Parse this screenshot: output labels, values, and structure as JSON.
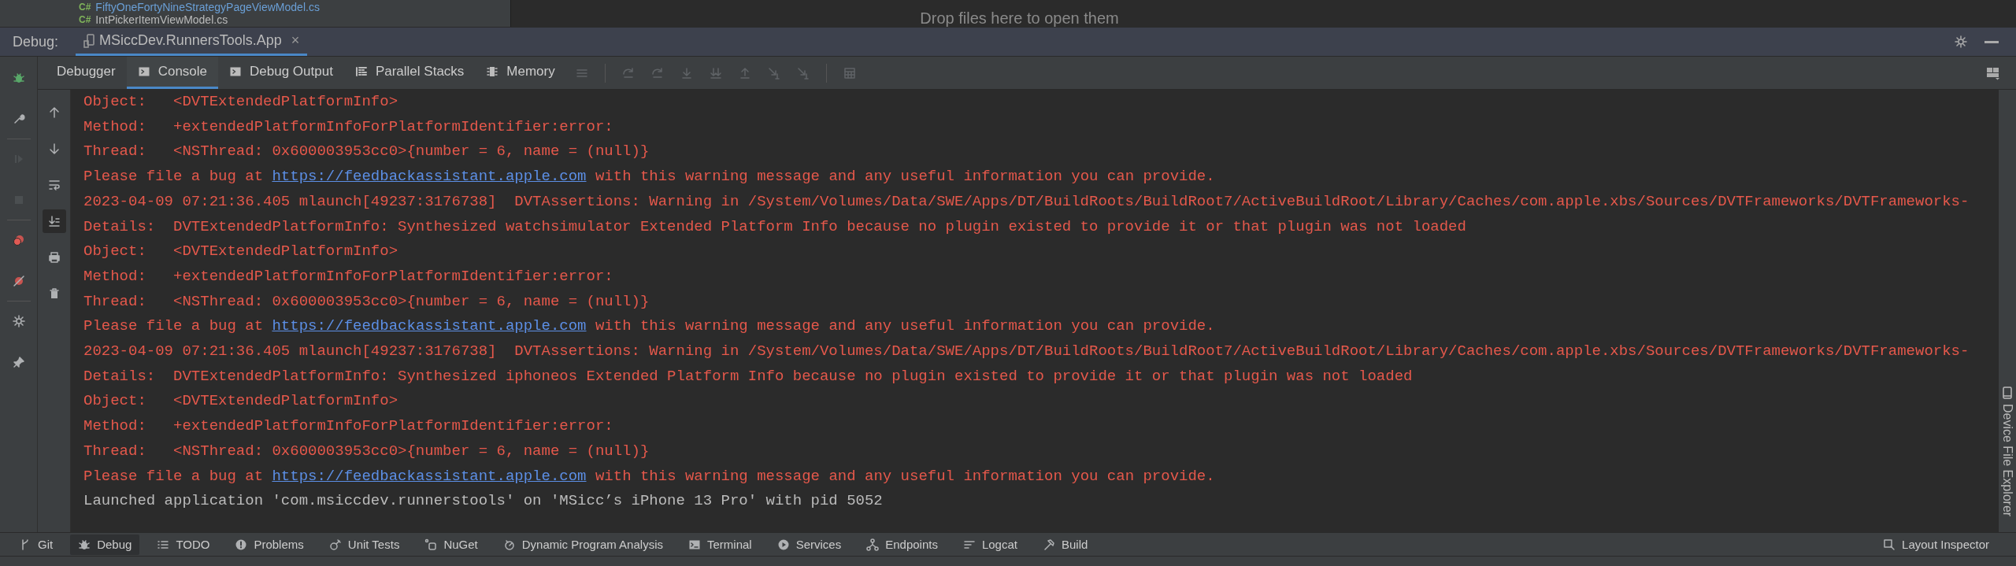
{
  "file_tree": {
    "files": [
      {
        "badge": "C#",
        "name": "FiftyOneFortyNineStrategyPageViewModel.cs"
      },
      {
        "badge": "C#",
        "name": "IntPickerItemViewModel.cs"
      }
    ]
  },
  "editor_hint": "Drop files here to open them",
  "debug_header": {
    "label": "Debug:",
    "session_tab": {
      "title": "MSiccDev.RunnersTools.App",
      "close": "×",
      "selected": true
    }
  },
  "debug_tabs": [
    {
      "label": "Debugger",
      "kind": "plain",
      "selected": false
    },
    {
      "label": "Console",
      "kind": "console",
      "selected": true
    },
    {
      "label": "Debug Output",
      "kind": "console",
      "selected": false
    },
    {
      "label": "Parallel Stacks",
      "kind": "stacks",
      "selected": false
    },
    {
      "label": "Memory",
      "kind": "memory",
      "selected": false
    }
  ],
  "toolbar": [
    {
      "kind": "menu",
      "disabled": true
    },
    {
      "kind": "stepover",
      "disabled": true
    },
    {
      "kind": "stepover",
      "disabled": true
    },
    {
      "kind": "stepinto",
      "disabled": true
    },
    {
      "kind": "forcestep",
      "disabled": true
    },
    {
      "kind": "stepout",
      "disabled": true
    },
    {
      "kind": "cursor",
      "disabled": true
    },
    {
      "kind": "cursor",
      "disabled": true
    },
    {
      "kind": "calculator",
      "disabled": true
    }
  ],
  "left_tools": [
    {
      "kind": "bug",
      "disabled": false
    },
    {
      "kind": "wrench",
      "disabled": false
    },
    {
      "kind": "resume",
      "disabled": true
    },
    {
      "kind": "stop",
      "disabled": true
    },
    {
      "kind": "breakpoints",
      "disabled": false
    },
    {
      "kind": "mute",
      "disabled": false
    },
    {
      "kind": "settings",
      "disabled": false
    },
    {
      "kind": "pin",
      "disabled": false
    }
  ],
  "console_tools": [
    {
      "kind": "up",
      "selected": false
    },
    {
      "kind": "down",
      "selected": false
    },
    {
      "kind": "wrap",
      "selected": false
    },
    {
      "kind": "scrollend",
      "selected": true
    },
    {
      "kind": "print",
      "selected": false
    },
    {
      "kind": "trash",
      "selected": false
    }
  ],
  "console_lines": [
    {
      "kind": "error",
      "text": "Object:   <DVTExtendedPlatformInfo>"
    },
    {
      "kind": "error",
      "text": "Method:   +extendedPlatformInfoForPlatformIdentifier:error:"
    },
    {
      "kind": "error",
      "text": "Thread:   <NSThread: 0x600003953cc0>{number = 6, name = (null)}"
    },
    {
      "kind": "error",
      "text": "Please file a bug at ",
      "link": "https://feedbackassistant.apple.com",
      "after": " with this warning message and any useful information you can provide."
    },
    {
      "kind": "error",
      "text": "2023-04-09 07:21:36.405 mlaunch[49237:3176738]  DVTAssertions: Warning in /System/Volumes/Data/SWE/Apps/DT/BuildRoots/BuildRoot7/ActiveBuildRoot/Library/Caches/com.apple.xbs/Sources/DVTFrameworks/DVTFrameworks-"
    },
    {
      "kind": "error",
      "text": "Details:  DVTExtendedPlatformInfo: Synthesized watchsimulator Extended Platform Info because no plugin existed to provide it or that plugin was not loaded"
    },
    {
      "kind": "error",
      "text": "Object:   <DVTExtendedPlatformInfo>"
    },
    {
      "kind": "error",
      "text": "Method:   +extendedPlatformInfoForPlatformIdentifier:error:"
    },
    {
      "kind": "error",
      "text": "Thread:   <NSThread: 0x600003953cc0>{number = 6, name = (null)}"
    },
    {
      "kind": "error",
      "text": "Please file a bug at ",
      "link": "https://feedbackassistant.apple.com",
      "after": " with this warning message and any useful information you can provide."
    },
    {
      "kind": "error",
      "text": "2023-04-09 07:21:36.405 mlaunch[49237:3176738]  DVTAssertions: Warning in /System/Volumes/Data/SWE/Apps/DT/BuildRoots/BuildRoot7/ActiveBuildRoot/Library/Caches/com.apple.xbs/Sources/DVTFrameworks/DVTFrameworks-"
    },
    {
      "kind": "error",
      "text": "Details:  DVTExtendedPlatformInfo: Synthesized iphoneos Extended Platform Info because no plugin existed to provide it or that plugin was not loaded"
    },
    {
      "kind": "error",
      "text": "Object:   <DVTExtendedPlatformInfo>"
    },
    {
      "kind": "error",
      "text": "Method:   +extendedPlatformInfoForPlatformIdentifier:error:"
    },
    {
      "kind": "error",
      "text": "Thread:   <NSThread: 0x600003953cc0>{number = 6, name = (null)}"
    },
    {
      "kind": "error",
      "text": "Please file a bug at ",
      "link": "https://feedbackassistant.apple.com",
      "after": " with this warning message and any useful information you can provide."
    },
    {
      "kind": "info",
      "text": "Launched application 'com.msiccdev.runnerstools' on 'MSicc’s iPhone 13 Pro' with pid 5052"
    }
  ],
  "side_panel": {
    "label": "Device File Explorer"
  },
  "bottom_tools": [
    {
      "label": "Git",
      "kind": "git",
      "selected": false
    },
    {
      "label": "Debug",
      "kind": "bug",
      "selected": true
    },
    {
      "label": "TODO",
      "kind": "list",
      "selected": false
    },
    {
      "label": "Problems",
      "kind": "problems",
      "selected": false
    },
    {
      "label": "Unit Tests",
      "kind": "tests",
      "selected": false
    },
    {
      "label": "NuGet",
      "kind": "nuget",
      "selected": false
    },
    {
      "label": "Dynamic Program Analysis",
      "kind": "dpa",
      "selected": false
    },
    {
      "label": "Terminal",
      "kind": "terminal",
      "selected": false
    },
    {
      "label": "Services",
      "kind": "services",
      "selected": false
    },
    {
      "label": "Endpoints",
      "kind": "endpoints",
      "selected": false
    },
    {
      "label": "Logcat",
      "kind": "logcat",
      "selected": false
    },
    {
      "label": "Build",
      "kind": "build",
      "selected": false
    }
  ],
  "right_bottom_tool": {
    "label": "Layout Inspector"
  }
}
